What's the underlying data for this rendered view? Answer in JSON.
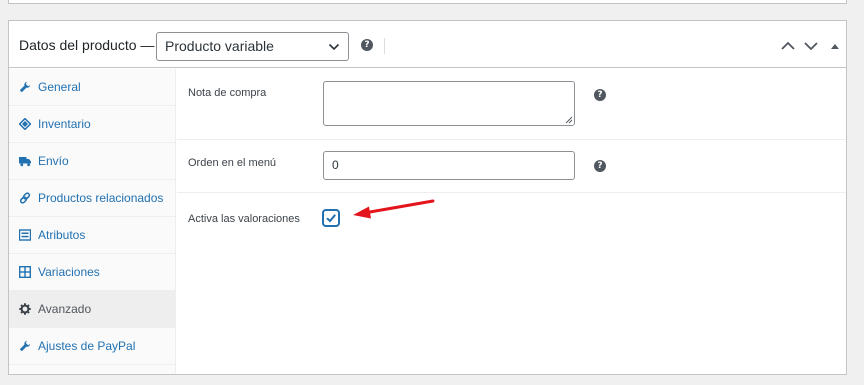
{
  "header": {
    "title": "Datos del producto",
    "title_separator": "—",
    "product_type": "Producto variable",
    "help_glyph": "?"
  },
  "tabs": [
    {
      "label": "General",
      "icon": "wrench-icon"
    },
    {
      "label": "Inventario",
      "icon": "tag-icon"
    },
    {
      "label": "Envío",
      "icon": "truck-icon"
    },
    {
      "label": "Productos relacionados",
      "icon": "link-icon"
    },
    {
      "label": "Atributos",
      "icon": "list-icon"
    },
    {
      "label": "Variaciones",
      "icon": "grid-icon"
    },
    {
      "label": "Avanzado",
      "icon": "gear-icon",
      "active": true
    },
    {
      "label": "Ajustes de PayPal",
      "icon": "wrench-icon"
    }
  ],
  "fields": {
    "purchase_note_label": "Nota de compra",
    "purchase_note_value": "",
    "menu_order_label": "Orden en el menú",
    "menu_order_value": "0",
    "reviews_label": "Activa las valoraciones",
    "reviews_checked": true
  },
  "colors": {
    "link": "#2271b1",
    "arrow": "#e3141b",
    "border": "#c3c4c7"
  }
}
